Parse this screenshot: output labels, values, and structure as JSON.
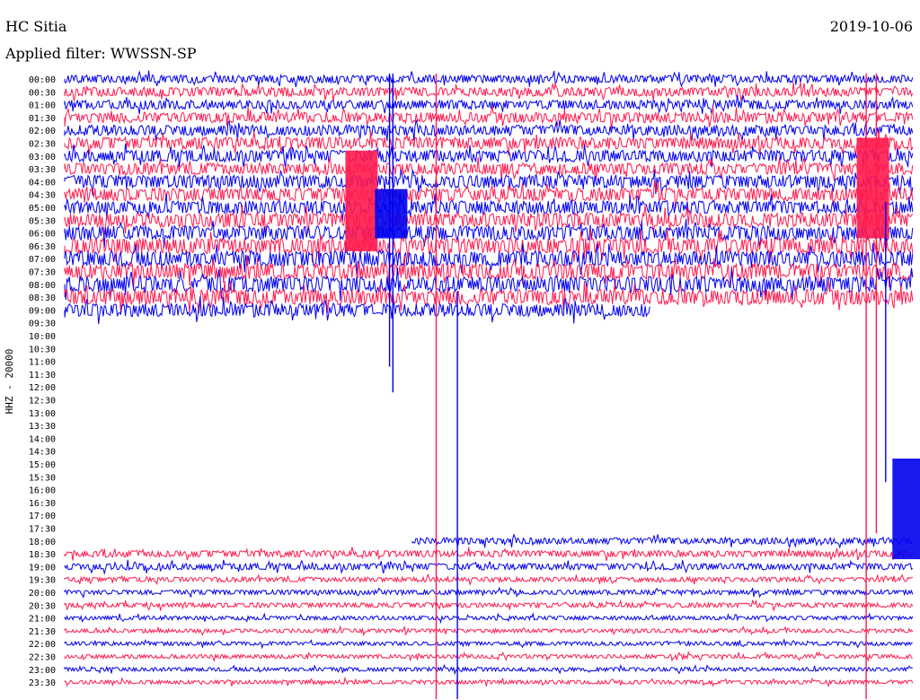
{
  "header": {
    "station": "HC Sitia",
    "filter": "Applied filter: WWSSN-SP",
    "date": "2019-10-06"
  },
  "colors": {
    "a": "#0000ee",
    "b": "#ff1a4d",
    "text": "#000000"
  },
  "chart_data": {
    "type": "helicorder",
    "channel_label": "HHZ - 20000",
    "rows": [
      {
        "time": "00:00",
        "color": "blue",
        "amp": 0.3,
        "start": 0,
        "end": 1
      },
      {
        "time": "00:30",
        "color": "red",
        "amp": 0.35,
        "start": 0,
        "end": 1
      },
      {
        "time": "01:00",
        "color": "blue",
        "amp": 0.35,
        "start": 0,
        "end": 1
      },
      {
        "time": "01:30",
        "color": "red",
        "amp": 0.4,
        "start": 0,
        "end": 1
      },
      {
        "time": "02:00",
        "color": "blue",
        "amp": 0.4,
        "start": 0,
        "end": 1
      },
      {
        "time": "02:30",
        "color": "red",
        "amp": 0.45,
        "start": 0,
        "end": 1
      },
      {
        "time": "03:00",
        "color": "blue",
        "amp": 0.45,
        "start": 0,
        "end": 1
      },
      {
        "time": "03:30",
        "color": "red",
        "amp": 0.45,
        "start": 0,
        "end": 1
      },
      {
        "time": "04:00",
        "color": "blue",
        "amp": 0.5,
        "start": 0,
        "end": 1
      },
      {
        "time": "04:30",
        "color": "red",
        "amp": 0.5,
        "start": 0,
        "end": 1
      },
      {
        "time": "05:00",
        "color": "blue",
        "amp": 0.5,
        "start": 0,
        "end": 1
      },
      {
        "time": "05:30",
        "color": "red",
        "amp": 0.55,
        "start": 0,
        "end": 1
      },
      {
        "time": "06:00",
        "color": "blue",
        "amp": 0.55,
        "start": 0,
        "end": 1
      },
      {
        "time": "06:30",
        "color": "red",
        "amp": 0.6,
        "start": 0,
        "end": 1
      },
      {
        "time": "07:00",
        "color": "blue",
        "amp": 0.6,
        "start": 0,
        "end": 1
      },
      {
        "time": "07:30",
        "color": "red",
        "amp": 0.6,
        "start": 0,
        "end": 1
      },
      {
        "time": "08:00",
        "color": "blue",
        "amp": 0.6,
        "start": 0,
        "end": 1
      },
      {
        "time": "08:30",
        "color": "red",
        "amp": 0.6,
        "start": 0,
        "end": 1
      },
      {
        "time": "09:00",
        "color": "blue",
        "amp": 0.5,
        "start": 0,
        "end": 0.69
      },
      {
        "time": "09:30",
        "color": "red",
        "amp": 0,
        "start": 0,
        "end": 0
      },
      {
        "time": "10:00",
        "color": "blue",
        "amp": 0,
        "start": 0,
        "end": 0
      },
      {
        "time": "10:30",
        "color": "red",
        "amp": 0,
        "start": 0,
        "end": 0
      },
      {
        "time": "11:00",
        "color": "blue",
        "amp": 0,
        "start": 0,
        "end": 0
      },
      {
        "time": "11:30",
        "color": "red",
        "amp": 0,
        "start": 0,
        "end": 0
      },
      {
        "time": "12:00",
        "color": "blue",
        "amp": 0,
        "start": 0,
        "end": 0
      },
      {
        "time": "12:30",
        "color": "red",
        "amp": 0,
        "start": 0,
        "end": 0
      },
      {
        "time": "13:00",
        "color": "blue",
        "amp": 0,
        "start": 0,
        "end": 0
      },
      {
        "time": "13:30",
        "color": "red",
        "amp": 0,
        "start": 0,
        "end": 0
      },
      {
        "time": "14:00",
        "color": "blue",
        "amp": 0,
        "start": 0,
        "end": 0
      },
      {
        "time": "14:30",
        "color": "red",
        "amp": 0,
        "start": 0,
        "end": 0
      },
      {
        "time": "15:00",
        "color": "blue",
        "amp": 0,
        "start": 0,
        "end": 0
      },
      {
        "time": "15:30",
        "color": "red",
        "amp": 0,
        "start": 0,
        "end": 0
      },
      {
        "time": "16:00",
        "color": "blue",
        "amp": 0,
        "start": 0,
        "end": 0
      },
      {
        "time": "16:30",
        "color": "red",
        "amp": 0,
        "start": 0,
        "end": 0
      },
      {
        "time": "17:00",
        "color": "blue",
        "amp": 0,
        "start": 0,
        "end": 0
      },
      {
        "time": "17:30",
        "color": "red",
        "amp": 0,
        "start": 0,
        "end": 0
      },
      {
        "time": "18:00",
        "color": "blue",
        "amp": 0.25,
        "start": 0.41,
        "end": 1
      },
      {
        "time": "18:30",
        "color": "red",
        "amp": 0.25,
        "start": 0,
        "end": 1
      },
      {
        "time": "19:00",
        "color": "blue",
        "amp": 0.25,
        "start": 0,
        "end": 1
      },
      {
        "time": "19:30",
        "color": "red",
        "amp": 0.18,
        "start": 0,
        "end": 1
      },
      {
        "time": "20:00",
        "color": "blue",
        "amp": 0.18,
        "start": 0,
        "end": 1
      },
      {
        "time": "20:30",
        "color": "red",
        "amp": 0.18,
        "start": 0,
        "end": 1
      },
      {
        "time": "21:00",
        "color": "blue",
        "amp": 0.15,
        "start": 0,
        "end": 1
      },
      {
        "time": "21:30",
        "color": "red",
        "amp": 0.15,
        "start": 0,
        "end": 1
      },
      {
        "time": "22:00",
        "color": "blue",
        "amp": 0.15,
        "start": 0,
        "end": 1
      },
      {
        "time": "22:30",
        "color": "red",
        "amp": 0.15,
        "start": 0,
        "end": 1
      },
      {
        "time": "23:00",
        "color": "blue",
        "amp": 0.15,
        "start": 0,
        "end": 1
      },
      {
        "time": "23:30",
        "color": "red",
        "amp": 0.15,
        "start": 0,
        "end": 1
      }
    ],
    "events": [
      {
        "x": 0.35,
        "row_from": 6,
        "row_to": 13,
        "color": "red",
        "kind": "burst"
      },
      {
        "x": 0.385,
        "row_from": 9,
        "row_to": 12,
        "color": "blue",
        "kind": "burst"
      },
      {
        "x": 0.383,
        "row_from": 0,
        "row_to": 22,
        "color": "blue",
        "kind": "spike"
      },
      {
        "x": 0.387,
        "row_from": 0,
        "row_to": 24,
        "color": "blue",
        "kind": "spike"
      },
      {
        "x": 0.438,
        "row_from": 0,
        "row_to": 48,
        "color": "red",
        "kind": "spike"
      },
      {
        "x": 0.463,
        "row_from": 17,
        "row_to": 48,
        "color": "blue",
        "kind": "spike"
      },
      {
        "x": 0.945,
        "row_from": 0,
        "row_to": 48,
        "color": "red",
        "kind": "spike"
      },
      {
        "x": 0.957,
        "row_from": 0,
        "row_to": 35,
        "color": "red",
        "kind": "spike"
      },
      {
        "x": 0.953,
        "row_from": 5,
        "row_to": 12,
        "color": "red",
        "kind": "burst"
      },
      {
        "x": 0.968,
        "row_from": 10,
        "row_to": 31,
        "color": "blue",
        "kind": "spike"
      },
      {
        "x": 0.995,
        "row_from": 30,
        "row_to": 37,
        "color": "blue",
        "kind": "burst"
      }
    ]
  }
}
